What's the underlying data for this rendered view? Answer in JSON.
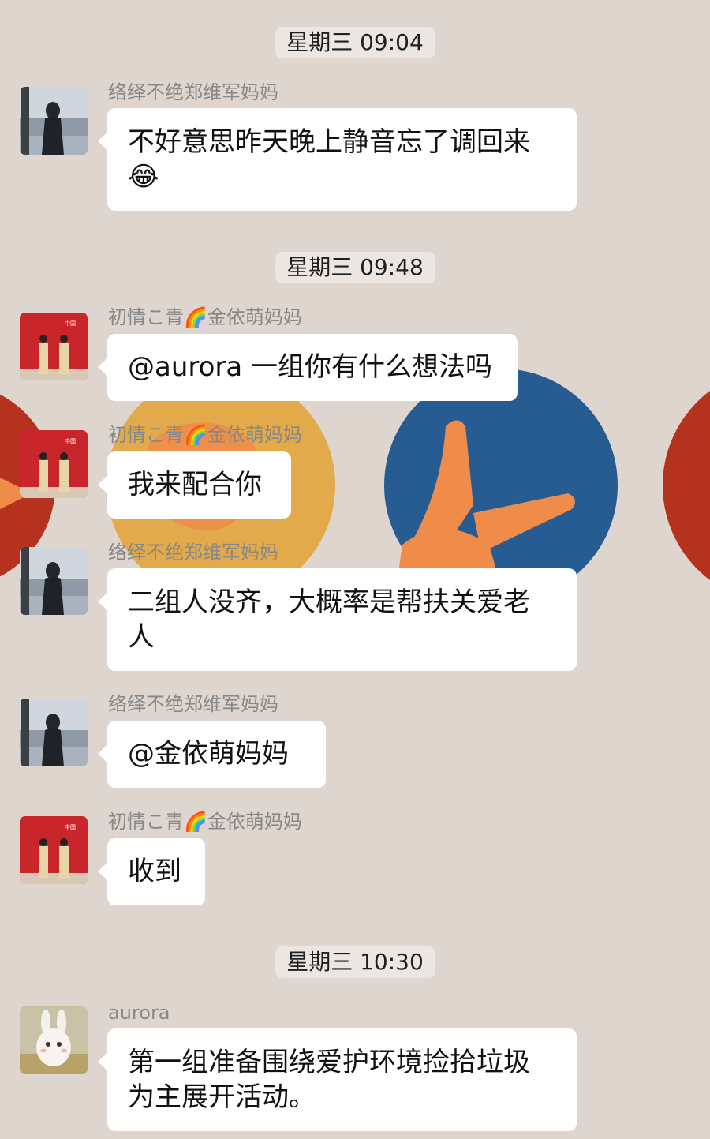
{
  "timestamps": [
    "星期三 09:04",
    "星期三 09:48",
    "星期三 10:30"
  ],
  "messages": [
    {
      "sender": "络绎不绝郑维军妈妈",
      "text": "不好意思昨天晚上静音忘了调回来",
      "emoji": "😂",
      "avatar": "beach-woman-avatar"
    },
    {
      "sender": "初情こ青🌈金依萌妈妈",
      "text": "@aurora 一组你有什么想法吗",
      "avatar": "red-wall-avatar"
    },
    {
      "sender": "初情こ青🌈金依萌妈妈",
      "text": "我来配合你",
      "avatar": "red-wall-avatar"
    },
    {
      "sender": "络绎不绝郑维军妈妈",
      "text": "二组人没齐，大概率是帮扶关爱老人",
      "avatar": "beach-woman-avatar"
    },
    {
      "sender": "络绎不绝郑维军妈妈",
      "text": "@金依萌妈妈",
      "avatar": "beach-woman-avatar"
    },
    {
      "sender": "初情こ青🌈金依萌妈妈",
      "text": "收到",
      "avatar": "red-wall-avatar"
    },
    {
      "sender": "aurora",
      "text": "第一组准备围绕爱护环境捡拾垃圾为主展开活动。",
      "avatar": "bunny-avatar"
    }
  ],
  "avatar_sign_text": "中国",
  "colors": {
    "background": "#ddd5ce",
    "bubble": "#ffffff",
    "timestamp_bg": "#ebe6e1",
    "sender_text": "#888888",
    "wallpaper_red": "#b5321f",
    "wallpaper_yellow": "#e2aa4a",
    "wallpaper_blue": "#265c92",
    "wallpaper_hand": "#f08c4a"
  }
}
